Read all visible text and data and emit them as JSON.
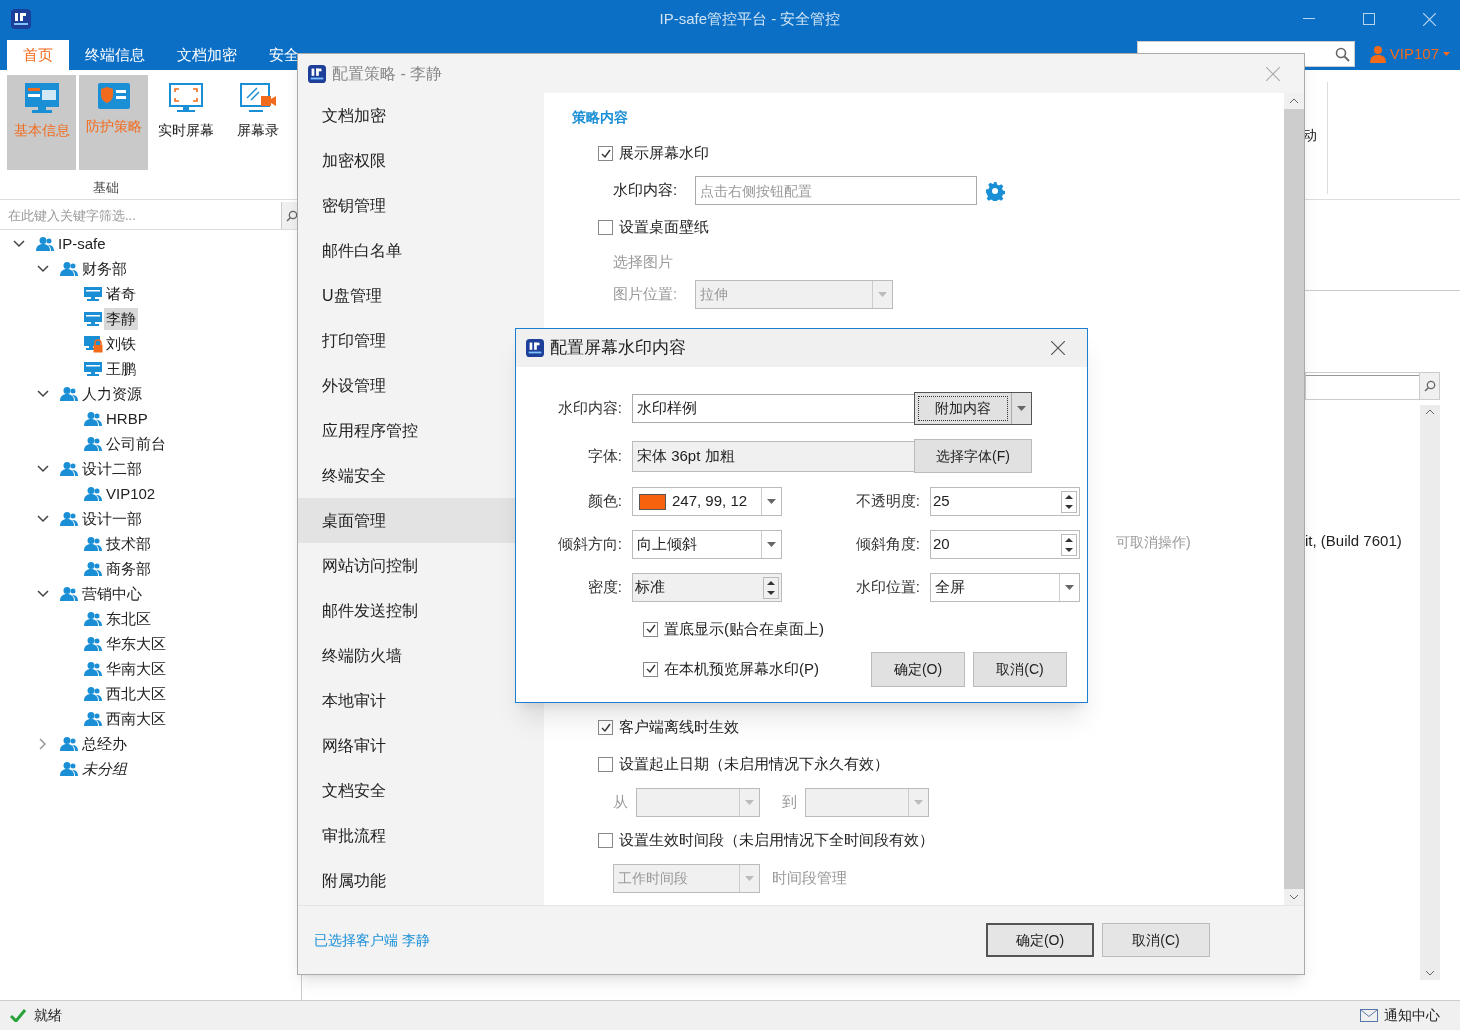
{
  "window": {
    "title": "IP-safe管控平台 - 安全管控"
  },
  "menu_tabs": [
    {
      "label": "首页",
      "selected": true
    },
    {
      "label": "终端信息",
      "selected": false
    },
    {
      "label": "文档加密",
      "selected": false
    },
    {
      "label": "安全",
      "selected": false
    }
  ],
  "user": {
    "name": "VIP107"
  },
  "ribbon": {
    "buttons": [
      {
        "label": "基本信息",
        "selected": true,
        "kind": "info"
      },
      {
        "label": "防护策略",
        "selected": true,
        "kind": "shield"
      },
      {
        "label": "实时屏幕",
        "selected": false,
        "kind": "screen"
      },
      {
        "label": "屏幕录",
        "selected": false,
        "kind": "record"
      }
    ],
    "group_label": "基础",
    "cut_text": "动"
  },
  "sidebar": {
    "filter_placeholder": "在此键入关键字筛选...",
    "tree": [
      {
        "label": "IP-safe",
        "kind": "group",
        "expanded": true,
        "children": [
          {
            "label": "财务部",
            "kind": "group",
            "expanded": true,
            "children": [
              {
                "label": "诸奇",
                "kind": "computer",
                "selected": false
              },
              {
                "label": "李静",
                "kind": "computer",
                "selected": true
              },
              {
                "label": "刘铁",
                "kind": "locked_computer",
                "selected": false
              },
              {
                "label": "王鹏",
                "kind": "computer",
                "selected": false
              }
            ]
          },
          {
            "label": "人力资源",
            "kind": "group",
            "expanded": true,
            "children": [
              {
                "label": "HRBP",
                "kind": "group",
                "selected": false
              },
              {
                "label": "公司前台",
                "kind": "group",
                "selected": false
              }
            ]
          },
          {
            "label": "设计二部",
            "kind": "group",
            "expanded": true,
            "children": [
              {
                "label": "VIP102",
                "kind": "group",
                "selected": false
              }
            ]
          },
          {
            "label": "设计一部",
            "kind": "group",
            "expanded": true,
            "children": [
              {
                "label": "技术部",
                "kind": "group",
                "selected": false
              },
              {
                "label": "商务部",
                "kind": "group",
                "selected": false
              }
            ]
          },
          {
            "label": "营销中心",
            "kind": "group",
            "expanded": true,
            "children": [
              {
                "label": "东北区",
                "kind": "group",
                "selected": false
              },
              {
                "label": "华东大区",
                "kind": "group",
                "selected": false
              },
              {
                "label": "华南大区",
                "kind": "group",
                "selected": false
              },
              {
                "label": "西北大区",
                "kind": "group",
                "selected": false
              },
              {
                "label": "西南大区",
                "kind": "group",
                "selected": false
              }
            ]
          },
          {
            "label": "总经办",
            "kind": "group",
            "expanded": false
          },
          {
            "label": "未分组",
            "kind": "ungrouped"
          }
        ]
      }
    ]
  },
  "background": {
    "build_text": "it, (Build 7601)"
  },
  "policy_dialog": {
    "title": "配置策略 - 李静",
    "nav": [
      {
        "label": "文档加密",
        "selected": false
      },
      {
        "label": "加密权限",
        "selected": false
      },
      {
        "label": "密钥管理",
        "selected": false
      },
      {
        "label": "邮件白名单",
        "selected": false
      },
      {
        "label": "U盘管理",
        "selected": false
      },
      {
        "label": "打印管理",
        "selected": false
      },
      {
        "label": "外设管理",
        "selected": false
      },
      {
        "label": "应用程序管控",
        "selected": false
      },
      {
        "label": "终端安全",
        "selected": false
      },
      {
        "label": "桌面管理",
        "selected": true
      },
      {
        "label": "网站访问控制",
        "selected": false
      },
      {
        "label": "邮件发送控制",
        "selected": false
      },
      {
        "label": "终端防火墙",
        "selected": false
      },
      {
        "label": "本地审计",
        "selected": false
      },
      {
        "label": "网络审计",
        "selected": false
      },
      {
        "label": "文档安全",
        "selected": false
      },
      {
        "label": "审批流程",
        "selected": false
      },
      {
        "label": "附属功能",
        "selected": false
      }
    ],
    "section_title": "策略内容",
    "options": [
      {
        "kind": "checkbox",
        "label": "展示屏幕水印",
        "checked": true
      },
      {
        "kind": "text_field",
        "label": "水印内容:",
        "placeholder": "点击右侧按钮配置"
      },
      {
        "kind": "checkbox",
        "label": "设置桌面壁纸",
        "checked": false
      },
      {
        "kind": "caption",
        "text": "选择图片"
      },
      {
        "kind": "select",
        "label": "图片位置:",
        "value": "拉伸"
      },
      {
        "kind": "hint",
        "text": "可取消操作)"
      },
      {
        "kind": "checkbox",
        "label": "客户端离线时生效",
        "checked": true
      },
      {
        "kind": "checkbox",
        "label": "设置起止日期（未启用情况下永久有效）",
        "checked": false
      },
      {
        "kind": "date_range",
        "from_label": "从",
        "to_label": "到"
      },
      {
        "kind": "checkbox",
        "label": "设置生效时间段（未启用情况下全时间段有效）",
        "checked": false
      },
      {
        "kind": "select_link",
        "value": "工作时间段",
        "link": "时间段管理"
      }
    ],
    "footer_link": "已选择客户端 李静",
    "buttons": [
      "确定(O)",
      "取消(C)"
    ]
  },
  "watermark_dialog": {
    "title": "配置屏幕水印内容",
    "content_label": "水印内容:",
    "content_value": "水印样例",
    "append_button": "附加内容",
    "font_label": "字体:",
    "font_value": "宋体 36pt 加粗",
    "font_button": "选择字体(F)",
    "color_label": "颜色:",
    "color": "#f7630c",
    "color_text": "247, 99, 12",
    "opacity_label": "不透明度:",
    "opacity_value": "25",
    "tilt_label": "倾斜方向:",
    "tilt_value": "向上倾斜",
    "angle_label": "倾斜角度:",
    "angle_value": "20",
    "density_label": "密度:",
    "density_value": "标准",
    "position_label": "水印位置:",
    "position_value": "全屏",
    "checks": [
      {
        "label": "置底显示(贴合在桌面上)",
        "checked": true
      },
      {
        "label": "在本机预览屏幕水印(P)",
        "checked": true
      }
    ],
    "buttons": [
      "确定(O)",
      "取消(C)"
    ]
  },
  "status_bar": {
    "text": "就绪",
    "notifications": "通知中心"
  }
}
